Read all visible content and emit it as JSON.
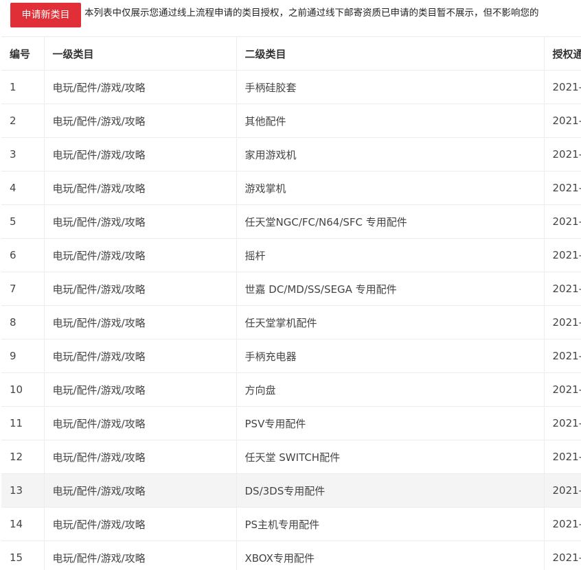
{
  "toolbar": {
    "apply_button_label": "申请新类目",
    "notice_text": "本列表中仅展示您通过线上流程申请的类目授权，之前通过线下邮寄资质已申请的类目暂不展示，但不影响您的"
  },
  "table": {
    "headers": {
      "number": "编号",
      "level1": "一级类目",
      "level2": "二级类目",
      "auth_date": "授权通"
    },
    "rows": [
      {
        "number": "1",
        "level1": "电玩/配件/游戏/攻略",
        "level2": "手柄硅胶套",
        "auth_date": "2021-"
      },
      {
        "number": "2",
        "level1": "电玩/配件/游戏/攻略",
        "level2": "其他配件",
        "auth_date": "2021-"
      },
      {
        "number": "3",
        "level1": "电玩/配件/游戏/攻略",
        "level2": "家用游戏机",
        "auth_date": "2021-"
      },
      {
        "number": "4",
        "level1": "电玩/配件/游戏/攻略",
        "level2": "游戏掌机",
        "auth_date": "2021-"
      },
      {
        "number": "5",
        "level1": "电玩/配件/游戏/攻略",
        "level2": "任天堂NGC/FC/N64/SFC 专用配件",
        "auth_date": "2021-"
      },
      {
        "number": "6",
        "level1": "电玩/配件/游戏/攻略",
        "level2": "摇杆",
        "auth_date": "2021-"
      },
      {
        "number": "7",
        "level1": "电玩/配件/游戏/攻略",
        "level2": "世嘉 DC/MD/SS/SEGA 专用配件",
        "auth_date": "2021-"
      },
      {
        "number": "8",
        "level1": "电玩/配件/游戏/攻略",
        "level2": "任天堂掌机配件",
        "auth_date": "2021-"
      },
      {
        "number": "9",
        "level1": "电玩/配件/游戏/攻略",
        "level2": "手柄充电器",
        "auth_date": "2021-"
      },
      {
        "number": "10",
        "level1": "电玩/配件/游戏/攻略",
        "level2": "方向盘",
        "auth_date": "2021-"
      },
      {
        "number": "11",
        "level1": "电玩/配件/游戏/攻略",
        "level2": "PSV专用配件",
        "auth_date": "2021-"
      },
      {
        "number": "12",
        "level1": "电玩/配件/游戏/攻略",
        "level2": "任天堂 SWITCH配件",
        "auth_date": "2021-"
      },
      {
        "number": "13",
        "level1": "电玩/配件/游戏/攻略",
        "level2": "DS/3DS专用配件",
        "auth_date": "2021-"
      },
      {
        "number": "14",
        "level1": "电玩/配件/游戏/攻略",
        "level2": "PS主机专用配件",
        "auth_date": "2021-"
      },
      {
        "number": "15",
        "level1": "电玩/配件/游戏/攻略",
        "level2": "XBOX专用配件",
        "auth_date": "2021-"
      }
    ]
  },
  "colors": {
    "accent": "#e02f37",
    "row_hover_bg": "#f4f4f4",
    "border": "#ececec"
  }
}
